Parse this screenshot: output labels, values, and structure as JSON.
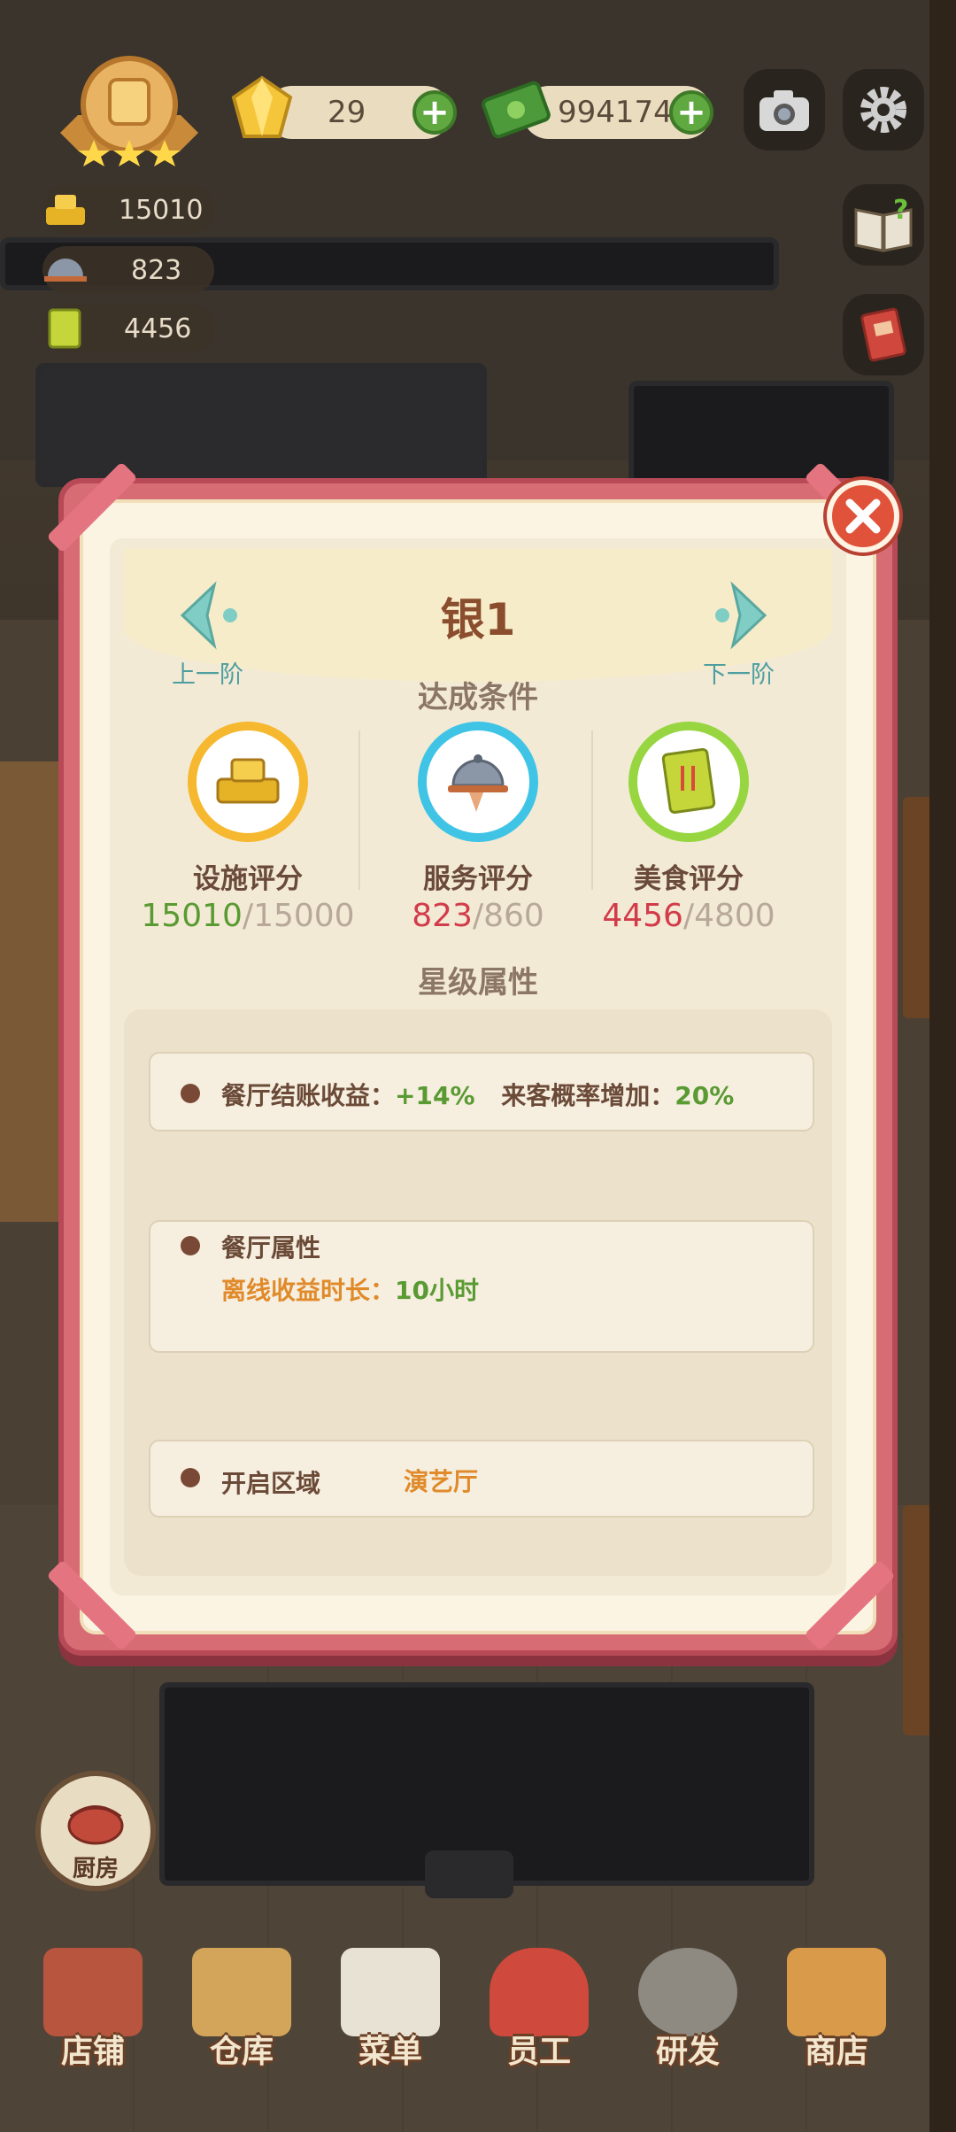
{
  "hud": {
    "gems": "29",
    "cash": "994174",
    "facility_score": "15010",
    "service_score": "823",
    "food_score": "4456"
  },
  "icons": {
    "trophy": "trophy-badge-icon",
    "gem": "gem-icon",
    "cash": "cash-icon",
    "camera": "camera-icon",
    "settings": "gear-icon",
    "help": "help-book-icon",
    "book": "recipe-book-icon"
  },
  "dialog": {
    "rank_title": "银1",
    "prev_label": "上一阶",
    "next_label": "下一阶",
    "conditions_title": "达成条件",
    "stats": [
      {
        "name": "设施评分",
        "current": "15010",
        "target": "/15000",
        "ring_color": "#f5b82e",
        "current_color": "#5a9a32"
      },
      {
        "name": "服务评分",
        "current": "823",
        "target": "/860",
        "ring_color": "#3fc4e6",
        "current_color": "#d23b4a"
      },
      {
        "name": "美食评分",
        "current": "4456",
        "target": "/4800",
        "ring_color": "#97d640",
        "current_color": "#d23b4a"
      }
    ],
    "star_attr_title": "星级属性",
    "props": {
      "checkout_label": "餐厅结账收益：",
      "checkout_value": "+14%",
      "visitor_label": "来客概率增加：",
      "visitor_value": "20%",
      "restaurant_attr_title": "餐厅属性",
      "offline_label": "离线收益时长：",
      "offline_value": "10小时",
      "unlock_label": "开启区域",
      "unlock_value": "演艺厅"
    }
  },
  "kitchen_button": "厨房",
  "nav": [
    "店铺",
    "仓库",
    "菜单",
    "员工",
    "研发",
    "商店"
  ],
  "colors": {
    "dialog_frame": "#d86c75",
    "paper": "#f3ead6",
    "green_value": "#5a9a32",
    "orange_value": "#e08a2a"
  }
}
